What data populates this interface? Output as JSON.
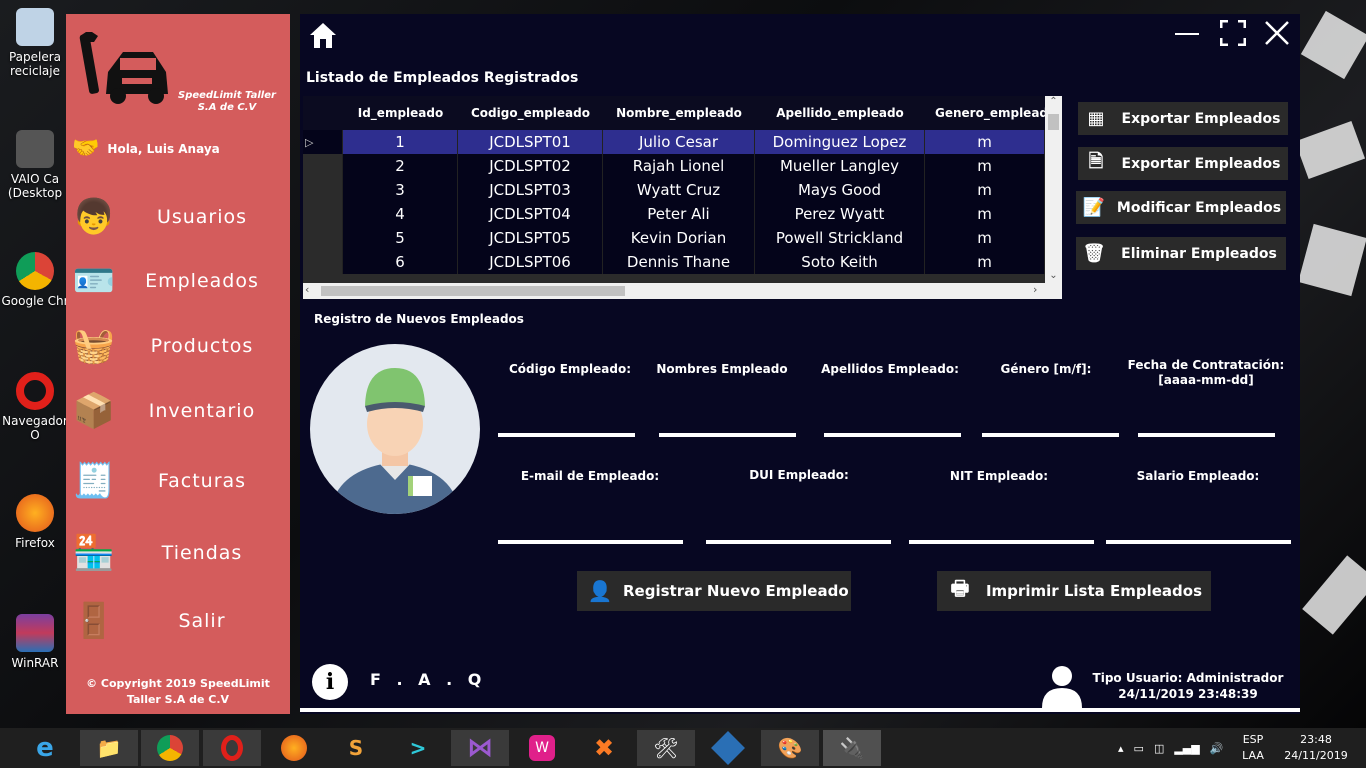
{
  "desktop": {
    "icons": [
      {
        "label": "Papelera\nreciclaje",
        "icon": "recycle-bin-icon"
      },
      {
        "label": "VAIO Ca\n(Desktop",
        "icon": "laptop-icon"
      },
      {
        "label": "Google Chr",
        "icon": "chrome-icon"
      },
      {
        "label": "Navegador O",
        "icon": "opera-icon"
      },
      {
        "label": "Firefox",
        "icon": "firefox-icon"
      },
      {
        "label": "WinRAR",
        "icon": "winrar-icon"
      }
    ]
  },
  "sidebar": {
    "logo_text_line1": "SpeedLimit Taller",
    "logo_text_line2": "S.A de C.V",
    "greeting": "Hola, Luis Anaya",
    "items": [
      {
        "label": "Usuarios",
        "icon": "user-avatar-icon"
      },
      {
        "label": "Empleados",
        "icon": "employee-badge-icon"
      },
      {
        "label": "Productos",
        "icon": "basket-icon"
      },
      {
        "label": "Inventario",
        "icon": "box-icon"
      },
      {
        "label": "Facturas",
        "icon": "cash-register-icon"
      },
      {
        "label": "Tiendas",
        "icon": "store-icon"
      },
      {
        "label": "Salir",
        "icon": "exit-icon"
      }
    ],
    "copyright_line1": "© Copyright 2019 SpeedLimit",
    "copyright_line2": "Taller S.A de C.V"
  },
  "main": {
    "list_title": "Listado de Empleados Registrados",
    "grid": {
      "columns": [
        "Id_empleado",
        "Codigo_empleado",
        "Nombre_empleado",
        "Apellido_empleado",
        "Genero_empleado"
      ],
      "rows": [
        [
          "1",
          "JCDLSPT01",
          "Julio Cesar",
          "Dominguez Lopez",
          "m"
        ],
        [
          "2",
          "JCDLSPT02",
          "Rajah Lionel",
          "Mueller Langley",
          "m"
        ],
        [
          "3",
          "JCDLSPT03",
          "Wyatt Cruz",
          "Mays Good",
          "m"
        ],
        [
          "4",
          "JCDLSPT04",
          "Peter Ali",
          "Perez Wyatt",
          "m"
        ],
        [
          "5",
          "JCDLSPT05",
          "Kevin Dorian",
          "Powell Strickland",
          "m"
        ],
        [
          "6",
          "JCDLSPT06",
          "Dennis Thane",
          "Soto Keith",
          "m"
        ]
      ],
      "selected_row": 0
    },
    "side_buttons": [
      {
        "label": "Exportar Empleados",
        "icon": "excel-icon"
      },
      {
        "label": "Exportar Empleados",
        "icon": "pdf-icon"
      },
      {
        "label": "Modificar Empleados",
        "icon": "edit-list-icon"
      },
      {
        "label": "Eliminar Empleados",
        "icon": "trash-icon"
      }
    ],
    "register_title": "Registro de Nuevos Empleados",
    "fields_row1": [
      {
        "label": "Código Empleado:",
        "value": ""
      },
      {
        "label": "Nombres Empleado",
        "value": ""
      },
      {
        "label": "Apellidos Empleado:",
        "value": ""
      },
      {
        "label": "Género [m/f]:",
        "value": ""
      },
      {
        "label": "Fecha de Contratación:\n[aaaa-mm-dd]",
        "value": ""
      }
    ],
    "fields_row2": [
      {
        "label": "E-mail de Empleado:",
        "value": ""
      },
      {
        "label": "DUI Empleado:",
        "value": ""
      },
      {
        "label": "NIT Empleado:",
        "value": ""
      },
      {
        "label": "Salario Empleado:",
        "value": ""
      }
    ],
    "register_button": "Registrar Nuevo Empleado",
    "print_button": "Imprimir Lista Empleados",
    "faq": "F . A . Q",
    "user_type": "Tipo Usuario: Administrador",
    "datetime": "24/11/2019 23:48:39"
  },
  "taskbar": {
    "apps": [
      "ie-icon",
      "file-explorer-icon",
      "chrome-icon",
      "opera-icon",
      "firefox-icon",
      "sublime-icon",
      "powershell-icon",
      "visual-studio-icon",
      "wamp-icon",
      "xampp-icon",
      "tools-icon",
      "virtualbox-icon",
      "paint-icon",
      "plugin-icon"
    ],
    "lang_line1": "ESP",
    "lang_line2": "LAA",
    "time": "23:48",
    "date": "24/11/2019"
  }
}
